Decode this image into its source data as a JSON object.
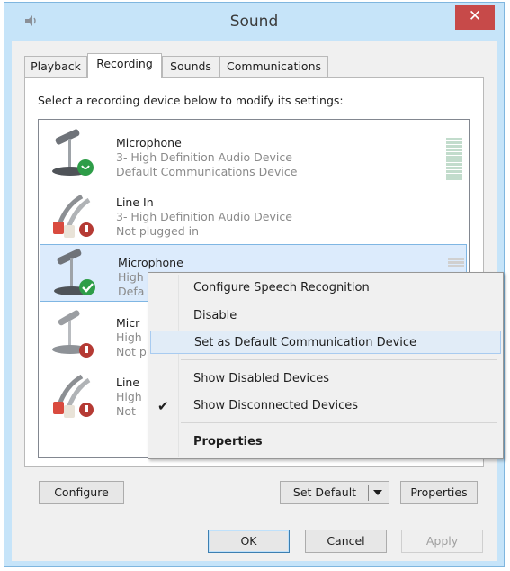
{
  "window": {
    "title": "Sound",
    "close_label": "✕"
  },
  "tabs": [
    {
      "label": "Playback"
    },
    {
      "label": "Recording"
    },
    {
      "label": "Sounds"
    },
    {
      "label": "Communications"
    }
  ],
  "instruction": "Select a recording device below to modify its settings:",
  "devices": [
    {
      "name": "Microphone",
      "line2": "3- High Definition Audio Device",
      "line3": "Default Communications Device",
      "icon": "microphone-icon",
      "badge": "green-phone-badge"
    },
    {
      "name": "Line In",
      "line2": "3- High Definition Audio Device",
      "line3": "Not plugged in",
      "icon": "line-in-icon",
      "badge": "red-down-badge"
    },
    {
      "name": "Microphone",
      "line2": "High",
      "line3": "Defa",
      "icon": "microphone-icon",
      "badge": "green-check-badge"
    },
    {
      "name": "Micr",
      "line2": "High",
      "line3": "Not p",
      "icon": "microphone-icon",
      "badge": "red-down-badge"
    },
    {
      "name": "Line",
      "line2": "High",
      "line3": "Not",
      "icon": "line-in-icon",
      "badge": "red-down-badge"
    }
  ],
  "context_menu": {
    "items": [
      {
        "label": "Configure Speech Recognition"
      },
      {
        "label": "Disable"
      },
      {
        "label": "Set as Default Communication Device"
      },
      {
        "label": "Show Disabled Devices"
      },
      {
        "label": "Show Disconnected Devices",
        "checked": true
      },
      {
        "label": "Properties"
      }
    ]
  },
  "buttons": {
    "configure": "Configure",
    "set_default": "Set Default",
    "properties": "Properties",
    "ok": "OK",
    "cancel": "Cancel",
    "apply": "Apply"
  },
  "colors": {
    "accent": "#3c7fb1",
    "close": "#c74a49",
    "selection": "#dcebfc"
  }
}
